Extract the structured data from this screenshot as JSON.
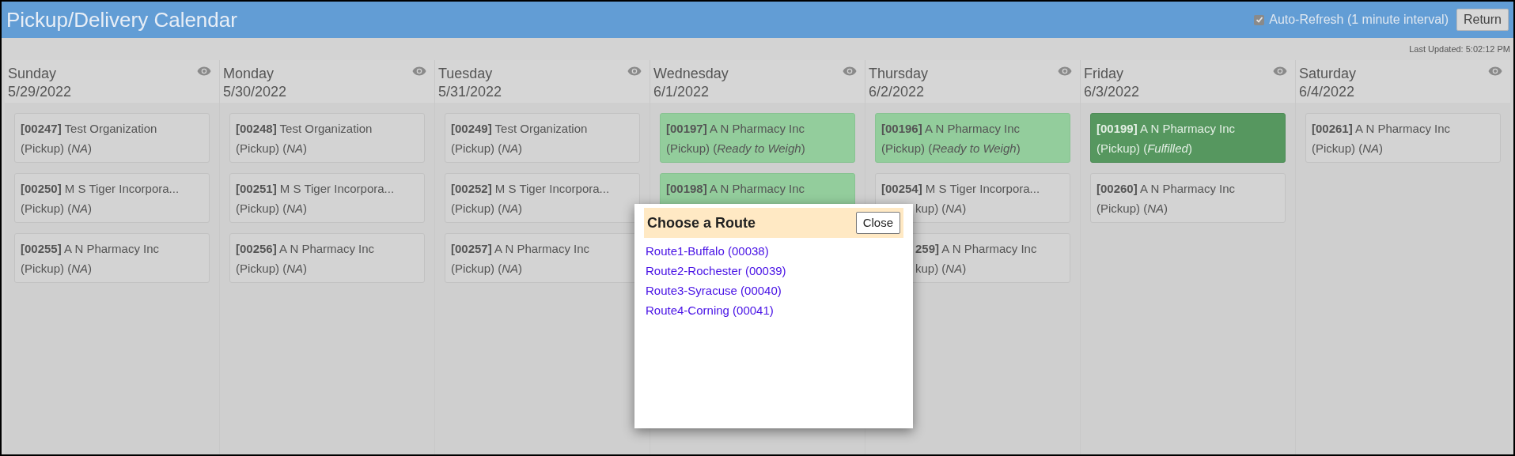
{
  "window": {
    "title": "Pickup/Delivery Calendar"
  },
  "auto_refresh": {
    "label": "Auto-Refresh (1 minute interval)",
    "checked": true
  },
  "return_button": "Return",
  "last_updated": "Last Updated: 5:02:12 PM",
  "days": [
    {
      "name": "Sunday",
      "date": "5/29/2022",
      "cards": [
        {
          "kind": "open",
          "lines": [
            "**[00247]** Test Organization",
            "(Pickup) (*NA*)"
          ]
        },
        {
          "kind": "open",
          "lines": [
            "**[00250]** M S Tiger Incorpora...",
            "(Pickup) (*NA*)"
          ]
        },
        {
          "kind": "open",
          "lines": [
            "**[00255]** A N Pharmacy Inc",
            "(Pickup) (*NA*)"
          ]
        }
      ]
    },
    {
      "name": "Monday",
      "date": "5/30/2022",
      "cards": [
        {
          "kind": "open",
          "lines": [
            "**[00248]** Test Organization",
            "(Pickup) (*NA*)"
          ]
        },
        {
          "kind": "open",
          "lines": [
            "**[00251]** M S Tiger Incorpora...",
            "(Pickup) (*NA*)"
          ]
        },
        {
          "kind": "open",
          "lines": [
            "**[00256]** A N Pharmacy Inc",
            "(Pickup) (*NA*)"
          ]
        }
      ]
    },
    {
      "name": "Tuesday",
      "date": "5/31/2022",
      "cards": [
        {
          "kind": "open",
          "lines": [
            "**[00249]** Test Organization",
            "(Pickup) (*NA*)"
          ]
        },
        {
          "kind": "open",
          "lines": [
            "**[00252]** M S Tiger Incorpora...",
            "(Pickup) (*NA*)"
          ]
        },
        {
          "kind": "open",
          "lines": [
            "**[00257]** A N Pharmacy Inc",
            "(Pickup) (*NA*)"
          ]
        }
      ]
    },
    {
      "name": "Wednesday",
      "date": "6/1/2022",
      "cards": [
        {
          "kind": "ready",
          "lines": [
            "**[00197]** A N Pharmacy Inc",
            "(Pickup) (*Ready to Weigh*)"
          ]
        },
        {
          "kind": "ready",
          "lines": [
            "**[00198]** A N Pharmacy Inc"
          ]
        }
      ]
    },
    {
      "name": "Thursday",
      "date": "6/2/2022",
      "cards": [
        {
          "kind": "ready",
          "lines": [
            "**[00196]** A N Pharmacy Inc",
            "(Pickup) (*Ready to Weigh*)"
          ]
        },
        {
          "kind": "open",
          "lines": [
            "**[00254]** M S Tiger Incorpora...",
            "kup) (*NA*)"
          ]
        },
        {
          "kind": "open",
          "lines": [
            "**259]** A N Pharmacy Inc",
            "kup) (*NA*)"
          ]
        }
      ]
    },
    {
      "name": "Friday",
      "date": "6/3/2022",
      "cards": [
        {
          "kind": "fulfilled",
          "lines": [
            "**[00199]** A N Pharmacy Inc",
            "(Pickup) (*Fulfilled*)"
          ]
        },
        {
          "kind": "open",
          "lines": [
            "**[00260]** A N Pharmacy Inc",
            "(Pickup) (*NA*)"
          ]
        }
      ]
    },
    {
      "name": "Saturday",
      "date": "6/4/2022",
      "cards": [
        {
          "kind": "open",
          "lines": [
            "**[00261]** A N Pharmacy Inc",
            "(Pickup) (*NA*)"
          ]
        }
      ]
    }
  ],
  "dialog": {
    "title": "Choose a Route",
    "close": "Close",
    "routes": [
      "Route1-Buffalo (00038)",
      "Route2-Rochester (00039)",
      "Route3-Syracuse (00040)",
      "Route4-Corning (00041)"
    ]
  }
}
